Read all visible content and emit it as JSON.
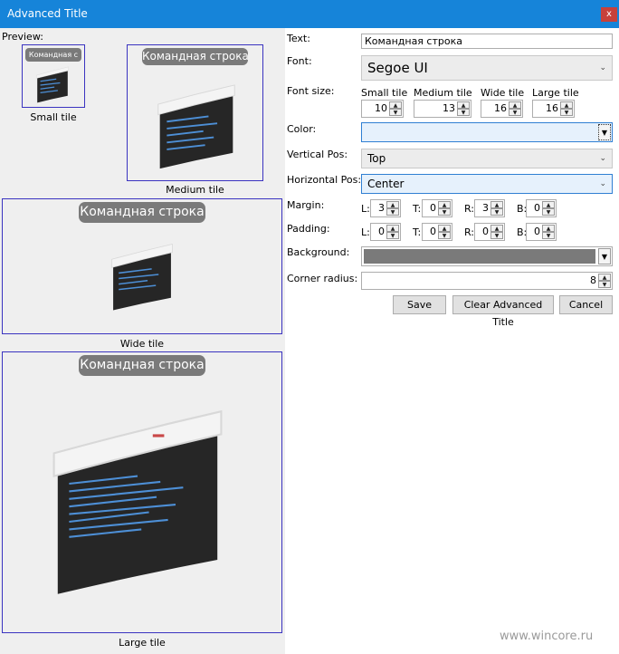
{
  "window": {
    "title": "Advanced Title",
    "close_glyph": "x"
  },
  "preview": {
    "label": "Preview:",
    "tiles": {
      "small": {
        "caption": "Small tile",
        "badge": "Командная строка",
        "badge_visible": "Командная с"
      },
      "medium": {
        "caption": "Medium tile",
        "badge": "Командная строка"
      },
      "wide": {
        "caption": "Wide tile",
        "badge": "Командная строка"
      },
      "large": {
        "caption": "Large tile",
        "badge": "Командная строка"
      }
    }
  },
  "form": {
    "text_label": "Text:",
    "text_value": "Командная строка",
    "font_label": "Font:",
    "font_value": "Segoe UI",
    "font_size_label": "Font size:",
    "sizes": [
      {
        "label": "Small tile",
        "value": "10"
      },
      {
        "label": "Medium tile",
        "value": "13"
      },
      {
        "label": "Wide tile",
        "value": "16"
      },
      {
        "label": "Large tile",
        "value": "16"
      }
    ],
    "color_label": "Color:",
    "color_value": "",
    "vertical_label": "Vertical Pos:",
    "vertical_value": "Top",
    "horizontal_label": "Horizontal Pos:",
    "horizontal_value": "Center",
    "margin_label": "Margin:",
    "margin": [
      {
        "label": "L:",
        "value": "3"
      },
      {
        "label": "T:",
        "value": "0"
      },
      {
        "label": "R:",
        "value": "3"
      },
      {
        "label": "B:",
        "value": "0"
      }
    ],
    "padding_label": "Padding:",
    "padding": [
      {
        "label": "L:",
        "value": "0"
      },
      {
        "label": "T:",
        "value": "0"
      },
      {
        "label": "R:",
        "value": "0"
      },
      {
        "label": "B:",
        "value": "0"
      }
    ],
    "background_label": "Background:",
    "background_color": "#7a7a7a",
    "corner_label": "Corner radius:",
    "corner_value": "8"
  },
  "buttons": {
    "save": "Save",
    "clear": "Clear Advanced Title",
    "cancel": "Cancel"
  },
  "watermark": "www.wincore.ru",
  "colors": {
    "titlebar": "#1684d9",
    "tile_border": "#3a33c0",
    "badge_bg": "#7a7a7a",
    "close_bg": "#c7413b",
    "color_field_bg": "#e6f1fc",
    "focus_border": "#2f7fd3"
  }
}
